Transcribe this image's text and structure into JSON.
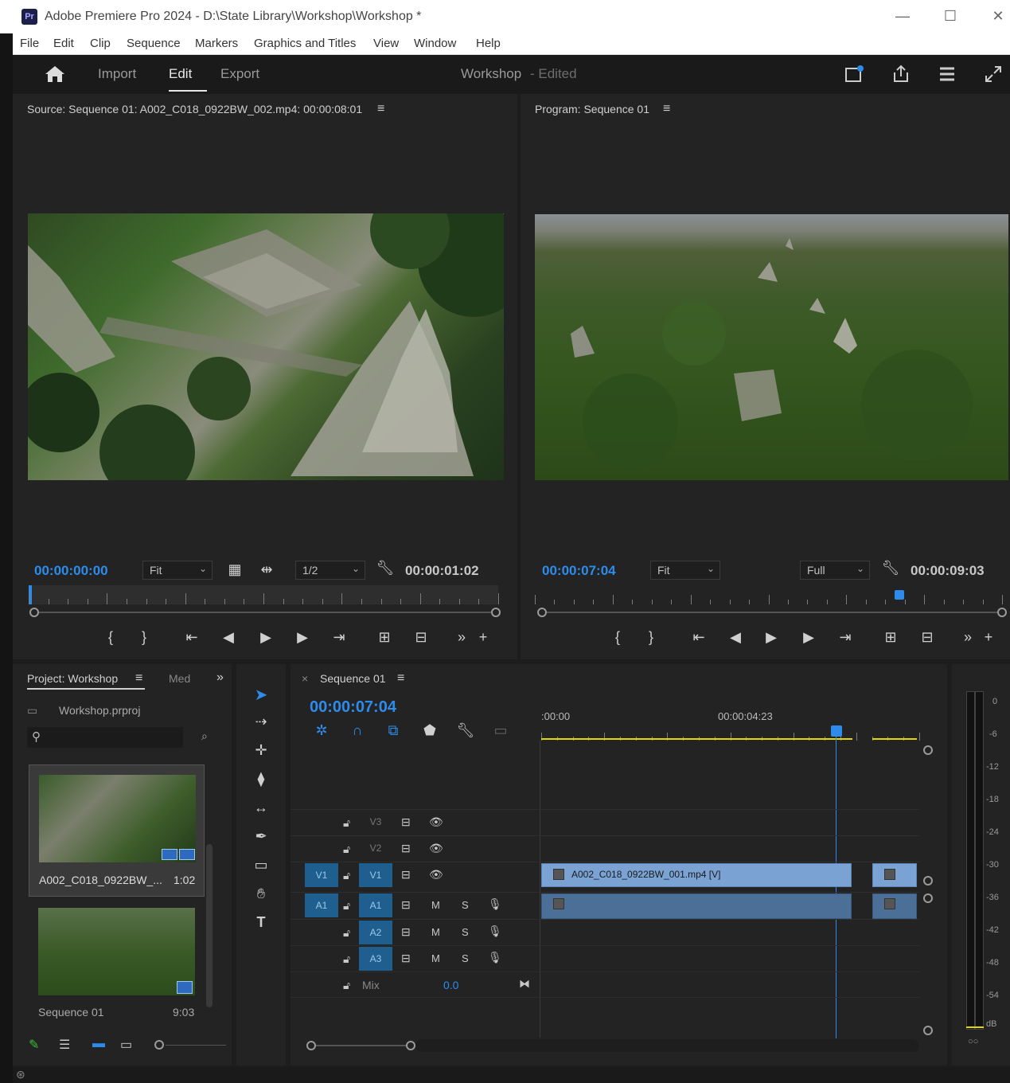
{
  "app": {
    "window_title": "Adobe Premiere Pro 2024 - D:\\State Library\\Workshop\\Workshop *",
    "logo": "Pr"
  },
  "menu": [
    "File",
    "Edit",
    "Clip",
    "Sequence",
    "Markers",
    "Graphics and Titles",
    "View",
    "Window",
    "Help"
  ],
  "workspace": {
    "tabs": [
      "Import",
      "Edit",
      "Export"
    ],
    "active_tab": "Edit",
    "project_name": "Workshop",
    "project_status": "- Edited"
  },
  "source_monitor": {
    "title": "Source: Sequence 01: A002_C018_0922BW_002.mp4: 00:00:08:01",
    "timecode": "00:00:00:00",
    "zoom": "Fit",
    "resolution": "1/2",
    "duration": "00:00:01:02"
  },
  "program_monitor": {
    "title": "Program: Sequence 01",
    "timecode": "00:00:07:04",
    "zoom": "Fit",
    "quality": "Full",
    "duration": "00:00:09:03"
  },
  "project_panel": {
    "title": "Project: Workshop",
    "next_tab": "Med",
    "file": "Workshop.prproj",
    "items": [
      {
        "name": "A002_C018_0922BW_...",
        "duration": "1:02"
      },
      {
        "name": "Sequence 01",
        "duration": "9:03"
      }
    ]
  },
  "timeline": {
    "title": "Sequence 01",
    "timecode": "00:00:07:04",
    "ruler_labels": [
      ":00:00",
      "00:00:04:23"
    ],
    "tracks_video": [
      {
        "target": "",
        "name": "V3"
      },
      {
        "target": "",
        "name": "V2"
      },
      {
        "target": "V1",
        "name": "V1"
      }
    ],
    "tracks_audio": [
      {
        "target": "A1",
        "name": "A1",
        "m": "M",
        "s": "S"
      },
      {
        "target": "",
        "name": "A2",
        "m": "M",
        "s": "S"
      },
      {
        "target": "",
        "name": "A3",
        "m": "M",
        "s": "S"
      }
    ],
    "mix_label": "Mix",
    "mix_value": "0.0",
    "clip_v1": "A002_C018_0922BW_001.mp4 [V]",
    "playhead_fraction": 0.78
  },
  "audio_meter": {
    "labels": [
      "0",
      "-6",
      "-12",
      "-18",
      "-24",
      "-30",
      "-36",
      "-42",
      "-48",
      "-54",
      "dB"
    ],
    "solo": "○○"
  },
  "colors": {
    "accent_blue": "#2d8ceb",
    "clip_video": "#7aa3d4",
    "clip_audio": "#4b6f97",
    "work_area": "#e5d500"
  }
}
